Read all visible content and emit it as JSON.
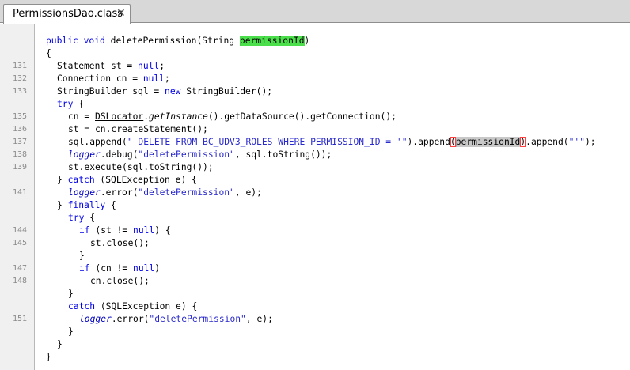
{
  "tab": {
    "title": "PermissionsDao.class",
    "close": "✕"
  },
  "colors": {
    "keyword": "#0000e6",
    "string": "#2a2acc",
    "highlight_occurrence": "#4be04b",
    "highlight_selection": "#c8c8c8",
    "gutter": "#f0f0f0"
  },
  "lines": [
    {
      "num": "",
      "indent": 0,
      "parts": [
        {
          "t": "public",
          "c": "kw"
        },
        {
          "t": " "
        },
        {
          "t": "void",
          "c": "kw"
        },
        {
          "t": " deletePermission(String "
        },
        {
          "t": "permissionId",
          "c": "hl-green"
        },
        {
          "t": ")"
        }
      ]
    },
    {
      "num": "",
      "indent": 0,
      "parts": [
        {
          "t": "{"
        }
      ]
    },
    {
      "num": "131",
      "indent": 1,
      "parts": [
        {
          "t": "Statement st = "
        },
        {
          "t": "null",
          "c": "kw"
        },
        {
          "t": ";"
        }
      ]
    },
    {
      "num": "132",
      "indent": 1,
      "parts": [
        {
          "t": "Connection cn = "
        },
        {
          "t": "null",
          "c": "kw"
        },
        {
          "t": ";"
        }
      ]
    },
    {
      "num": "133",
      "indent": 1,
      "parts": [
        {
          "t": "StringBuilder sql = "
        },
        {
          "t": "new",
          "c": "kw"
        },
        {
          "t": " StringBuilder();"
        }
      ]
    },
    {
      "num": "",
      "indent": 1,
      "parts": [
        {
          "t": "try",
          "c": "kw"
        },
        {
          "t": " {"
        }
      ]
    },
    {
      "num": "135",
      "indent": 2,
      "parts": [
        {
          "t": "cn = "
        },
        {
          "t": "DSLocator",
          "c": "ul"
        },
        {
          "t": "."
        },
        {
          "t": "getInstance",
          "c": "ital"
        },
        {
          "t": "().getDataSource().getConnection();"
        }
      ]
    },
    {
      "num": "136",
      "indent": 2,
      "parts": [
        {
          "t": "st = cn.createStatement();"
        }
      ]
    },
    {
      "num": "137",
      "indent": 2,
      "parts": [
        {
          "t": "sql.append("
        },
        {
          "t": "\" DELETE FROM BC_UDV3_ROLES WHERE PERMISSION_ID = '\"",
          "c": "str"
        },
        {
          "t": ").append"
        },
        {
          "t": "(",
          "c": "caret-open"
        },
        {
          "t": "permissionId",
          "c": "hl-gray"
        },
        {
          "t": ")",
          "c": "caret-close"
        },
        {
          "t": ".append("
        },
        {
          "t": "\"'\"",
          "c": "str"
        },
        {
          "t": ");"
        }
      ]
    },
    {
      "num": "138",
      "indent": 2,
      "parts": [
        {
          "t": "logger",
          "c": "fld"
        },
        {
          "t": ".debug("
        },
        {
          "t": "\"deletePermission\"",
          "c": "str"
        },
        {
          "t": ", sql.toString());"
        }
      ]
    },
    {
      "num": "139",
      "indent": 2,
      "parts": [
        {
          "t": "st.execute(sql.toString());"
        }
      ]
    },
    {
      "num": "",
      "indent": 1,
      "parts": [
        {
          "t": "} "
        },
        {
          "t": "catch",
          "c": "kw"
        },
        {
          "t": " (SQLException e) {"
        }
      ]
    },
    {
      "num": "141",
      "indent": 2,
      "parts": [
        {
          "t": "logger",
          "c": "fld"
        },
        {
          "t": ".error("
        },
        {
          "t": "\"deletePermission\"",
          "c": "str"
        },
        {
          "t": ", e);"
        }
      ]
    },
    {
      "num": "",
      "indent": 1,
      "parts": [
        {
          "t": "} "
        },
        {
          "t": "finally",
          "c": "kw"
        },
        {
          "t": " {"
        }
      ]
    },
    {
      "num": "",
      "indent": 2,
      "parts": [
        {
          "t": "try",
          "c": "kw"
        },
        {
          "t": " {"
        }
      ]
    },
    {
      "num": "144",
      "indent": 3,
      "parts": [
        {
          "t": "if",
          "c": "kw"
        },
        {
          "t": " (st != "
        },
        {
          "t": "null",
          "c": "kw"
        },
        {
          "t": ") {"
        }
      ]
    },
    {
      "num": "145",
      "indent": 4,
      "parts": [
        {
          "t": "st.close();"
        }
      ]
    },
    {
      "num": "",
      "indent": 3,
      "parts": [
        {
          "t": "}"
        }
      ]
    },
    {
      "num": "147",
      "indent": 3,
      "parts": [
        {
          "t": "if",
          "c": "kw"
        },
        {
          "t": " (cn != "
        },
        {
          "t": "null",
          "c": "kw"
        },
        {
          "t": ")"
        }
      ]
    },
    {
      "num": "148",
      "indent": 4,
      "parts": [
        {
          "t": "cn.close();"
        }
      ]
    },
    {
      "num": "",
      "indent": 2,
      "parts": [
        {
          "t": "}"
        }
      ]
    },
    {
      "num": "",
      "indent": 2,
      "parts": [
        {
          "t": "catch",
          "c": "kw"
        },
        {
          "t": " (SQLException e) {"
        }
      ]
    },
    {
      "num": "151",
      "indent": 3,
      "parts": [
        {
          "t": "logger",
          "c": "fld"
        },
        {
          "t": ".error("
        },
        {
          "t": "\"deletePermission\"",
          "c": "str"
        },
        {
          "t": ", e);"
        }
      ]
    },
    {
      "num": "",
      "indent": 2,
      "parts": [
        {
          "t": "}"
        }
      ]
    },
    {
      "num": "",
      "indent": 1,
      "parts": [
        {
          "t": "}"
        }
      ]
    },
    {
      "num": "",
      "indent": 0,
      "parts": [
        {
          "t": "}"
        }
      ]
    }
  ]
}
